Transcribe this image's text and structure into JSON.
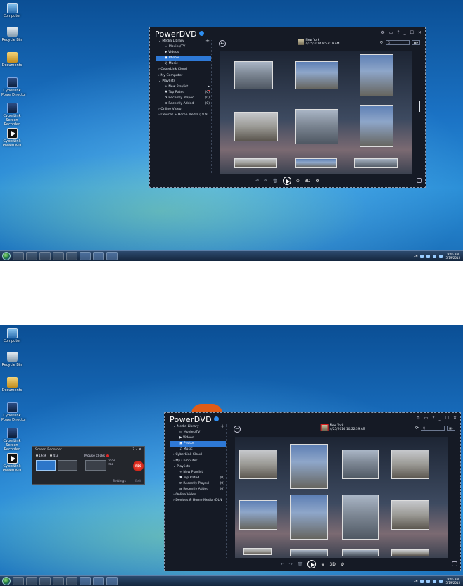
{
  "desktop_icons": [
    {
      "label": "Computer",
      "icon": "computer-icon"
    },
    {
      "label": "Recycle Bin",
      "icon": "recycle-bin-icon"
    },
    {
      "label": "Documents",
      "icon": "documents-icon"
    },
    {
      "label": "CyberLink PowerDirector",
      "icon": "powerdirector-icon"
    },
    {
      "label": "CyberLink Screen Recorder",
      "icon": "screen-recorder-icon"
    },
    {
      "label": "CyberLink PowerDVD",
      "icon": "powerdvd-icon"
    }
  ],
  "powerdvd": {
    "title": "PowerDVD",
    "controls": {
      "settings": "⚙",
      "mini": "▭",
      "help": "?",
      "minimize": "_",
      "maximize": "☐",
      "close": "✕"
    },
    "sidebar": [
      {
        "label": "Media Library",
        "type": "section",
        "plus": "+"
      },
      {
        "label": "Movies/TV",
        "type": "sub"
      },
      {
        "label": "Videos",
        "type": "sub"
      },
      {
        "label": "Photos",
        "type": "sub",
        "selected": true
      },
      {
        "label": "Music",
        "type": "sub"
      },
      {
        "label": "CyberLink Cloud",
        "type": "section"
      },
      {
        "label": "My Computer",
        "type": "section"
      },
      {
        "label": "Playlists",
        "type": "section"
      },
      {
        "label": "New Playlist",
        "type": "sub"
      },
      {
        "label": "Top Rated",
        "type": "sub",
        "count": "(0)"
      },
      {
        "label": "Recently Played",
        "type": "sub",
        "count": "(0)"
      },
      {
        "label": "Recently Added",
        "type": "sub",
        "count": "(0)"
      },
      {
        "label": "Online Video",
        "type": "section"
      },
      {
        "label": "Devices & Home Media (DLN",
        "type": "section"
      }
    ],
    "album": {
      "title": "New York",
      "date_1": "4/25/2014 9:53:19 AM",
      "date_2": "4/25/2014 10:22:39 AM"
    },
    "search_placeholder": "Q",
    "view_label": "▦▾",
    "bottom_bar": {
      "undo": "↶",
      "redo": "↷",
      "delete": "🗑",
      "zoom": "⊕",
      "label_3d": "3D",
      "settings": "⚙"
    }
  },
  "screen_recorder": {
    "title": "Screen Recorder",
    "controls": "? – ✕",
    "ratio_16_9": "16:9",
    "ratio_4_3": "4:3",
    "mouse_clicks": "Mouse clicks",
    "width_val": "1024",
    "height_val": "768",
    "rec_label": "REC",
    "settings_label": "Settings",
    "exit_label": "Exit"
  },
  "taskbar": {
    "tray_lang": "EN",
    "clock_time": "9:46 AM",
    "clock_date": "5/19/2015"
  }
}
